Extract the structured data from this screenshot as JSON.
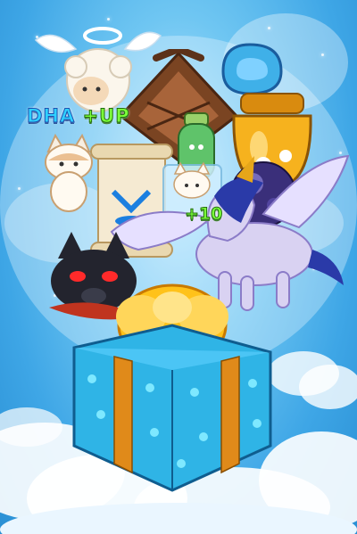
{
  "scene": {
    "background_colors": [
      "#bfe9ff",
      "#6fc6f2",
      "#3ea6e6",
      "#2a8fd4"
    ]
  },
  "labels": {
    "dha": "DHA",
    "up": "+UP",
    "plus_value": "+10"
  },
  "items": {
    "angel_sheep": "angel-sheep-icon",
    "basket": "basket-icon",
    "handle": "handle-icon",
    "honey_jar": "honey-jar-icon",
    "green_bottle": "green-bottle-icon",
    "cat_left": "cat-icon",
    "scroll": "scroll-icon",
    "cat_in_cube": "cat-cube-icon",
    "dark_orb": "dark-orb-icon",
    "pegasus": "pegasus-icon",
    "black_wolf": "black-wolf-icon",
    "gift_box": "gift-box-icon"
  },
  "colors": {
    "gift_box": "#2fb4e6",
    "ribbon": "#e08a1a",
    "bow": "#ffc21a",
    "pegasus": "#d9d2f2",
    "pegasus_mane": "#2a3aa8",
    "honey": "#f6b21e",
    "wolf": "#23242e",
    "wolf_eyes": "#ff2a2a"
  }
}
